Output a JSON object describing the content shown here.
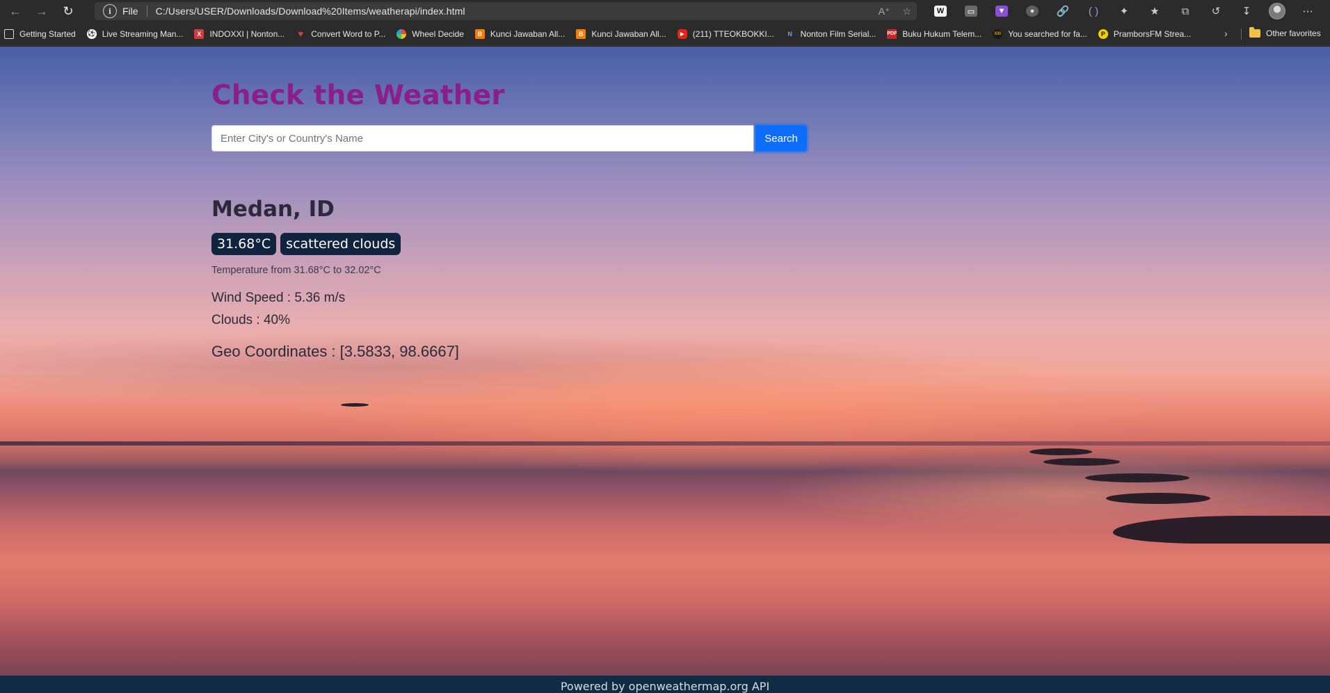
{
  "browser": {
    "address_scheme": "File",
    "url": "C:/Users/USER/Downloads/Download%20Items/weatherapi/index.html",
    "bookmarks": [
      {
        "label": "Getting Started",
        "icon": "page-icon",
        "color": "#e8e8e8"
      },
      {
        "label": "Live Streaming Man...",
        "icon": "soccer-ball-icon",
        "color": "#ffffff"
      },
      {
        "label": "INDOXXI | Nonton...",
        "icon": "indoxxi-icon",
        "color": "#d23b3b"
      },
      {
        "label": "Convert Word to P...",
        "icon": "heart-icon",
        "color": "#e23b3b"
      },
      {
        "label": "Wheel Decide",
        "icon": "wheel-icon",
        "color": "#4aa3df"
      },
      {
        "label": "Kunci Jawaban All...",
        "icon": "blogger-icon",
        "color": "#f57d00"
      },
      {
        "label": "Kunci Jawaban All...",
        "icon": "blogger-icon",
        "color": "#f57d00"
      },
      {
        "label": "(211) TTEOKBOKKI...",
        "icon": "youtube-icon",
        "color": "#e62117"
      },
      {
        "label": "Nonton Film Serial...",
        "icon": "nf-icon",
        "color": "#3a6ea5"
      },
      {
        "label": "Buku Hukum Telem...",
        "icon": "pdf-icon",
        "color": "#c62828"
      },
      {
        "label": "You searched for fa...",
        "icon": "xxi-icon",
        "color": "#d4b000"
      },
      {
        "label": "PramborsFM Strea...",
        "icon": "prambors-icon",
        "color": "#f2d100"
      }
    ],
    "other_favorites": "Other favorites"
  },
  "page": {
    "title": "Check the Weather",
    "search_placeholder": "Enter City's or Country's Name",
    "search_button": "Search",
    "city": "Medan, ID",
    "temperature_badge": "31.68°C",
    "description_badge": "scattered clouds",
    "temperature_range": "Temperature from 31.68°C to 32.02°C",
    "wind_speed": "Wind Speed : 5.36 m/s",
    "clouds": "Clouds : 40%",
    "geo_coordinates": "Geo Coordinates : [3.5833, 98.6667]"
  },
  "footer": {
    "text": "Powered by openweathermap.org API"
  },
  "colors": {
    "title": "#8a1f8a",
    "search_button": "#0d6efd",
    "badge": "#10233f",
    "footer": "#0f2c44"
  }
}
